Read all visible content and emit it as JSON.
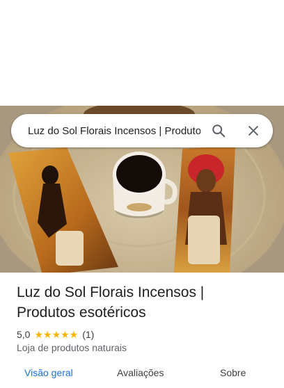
{
  "search": {
    "value": "Luz do Sol Florais Incensos | Produtos esotéricos",
    "search_icon": "search-icon",
    "close_icon": "close-icon"
  },
  "place": {
    "title_line1": "Luz do Sol Florais Incensos |",
    "title_line2": "Produtos esotéricos",
    "rating": "5,0",
    "stars": "★★★★★",
    "review_count": "(1)",
    "category": "Loja de produtos naturais"
  },
  "tabs": [
    {
      "label": "Visão geral",
      "active": true
    },
    {
      "label": "Avaliações",
      "active": false
    },
    {
      "label": "Sobre",
      "active": false
    }
  ],
  "colors": {
    "accent": "#1a73e8",
    "star": "#f5b400",
    "text": "#202124",
    "secondary": "#5f6368"
  }
}
